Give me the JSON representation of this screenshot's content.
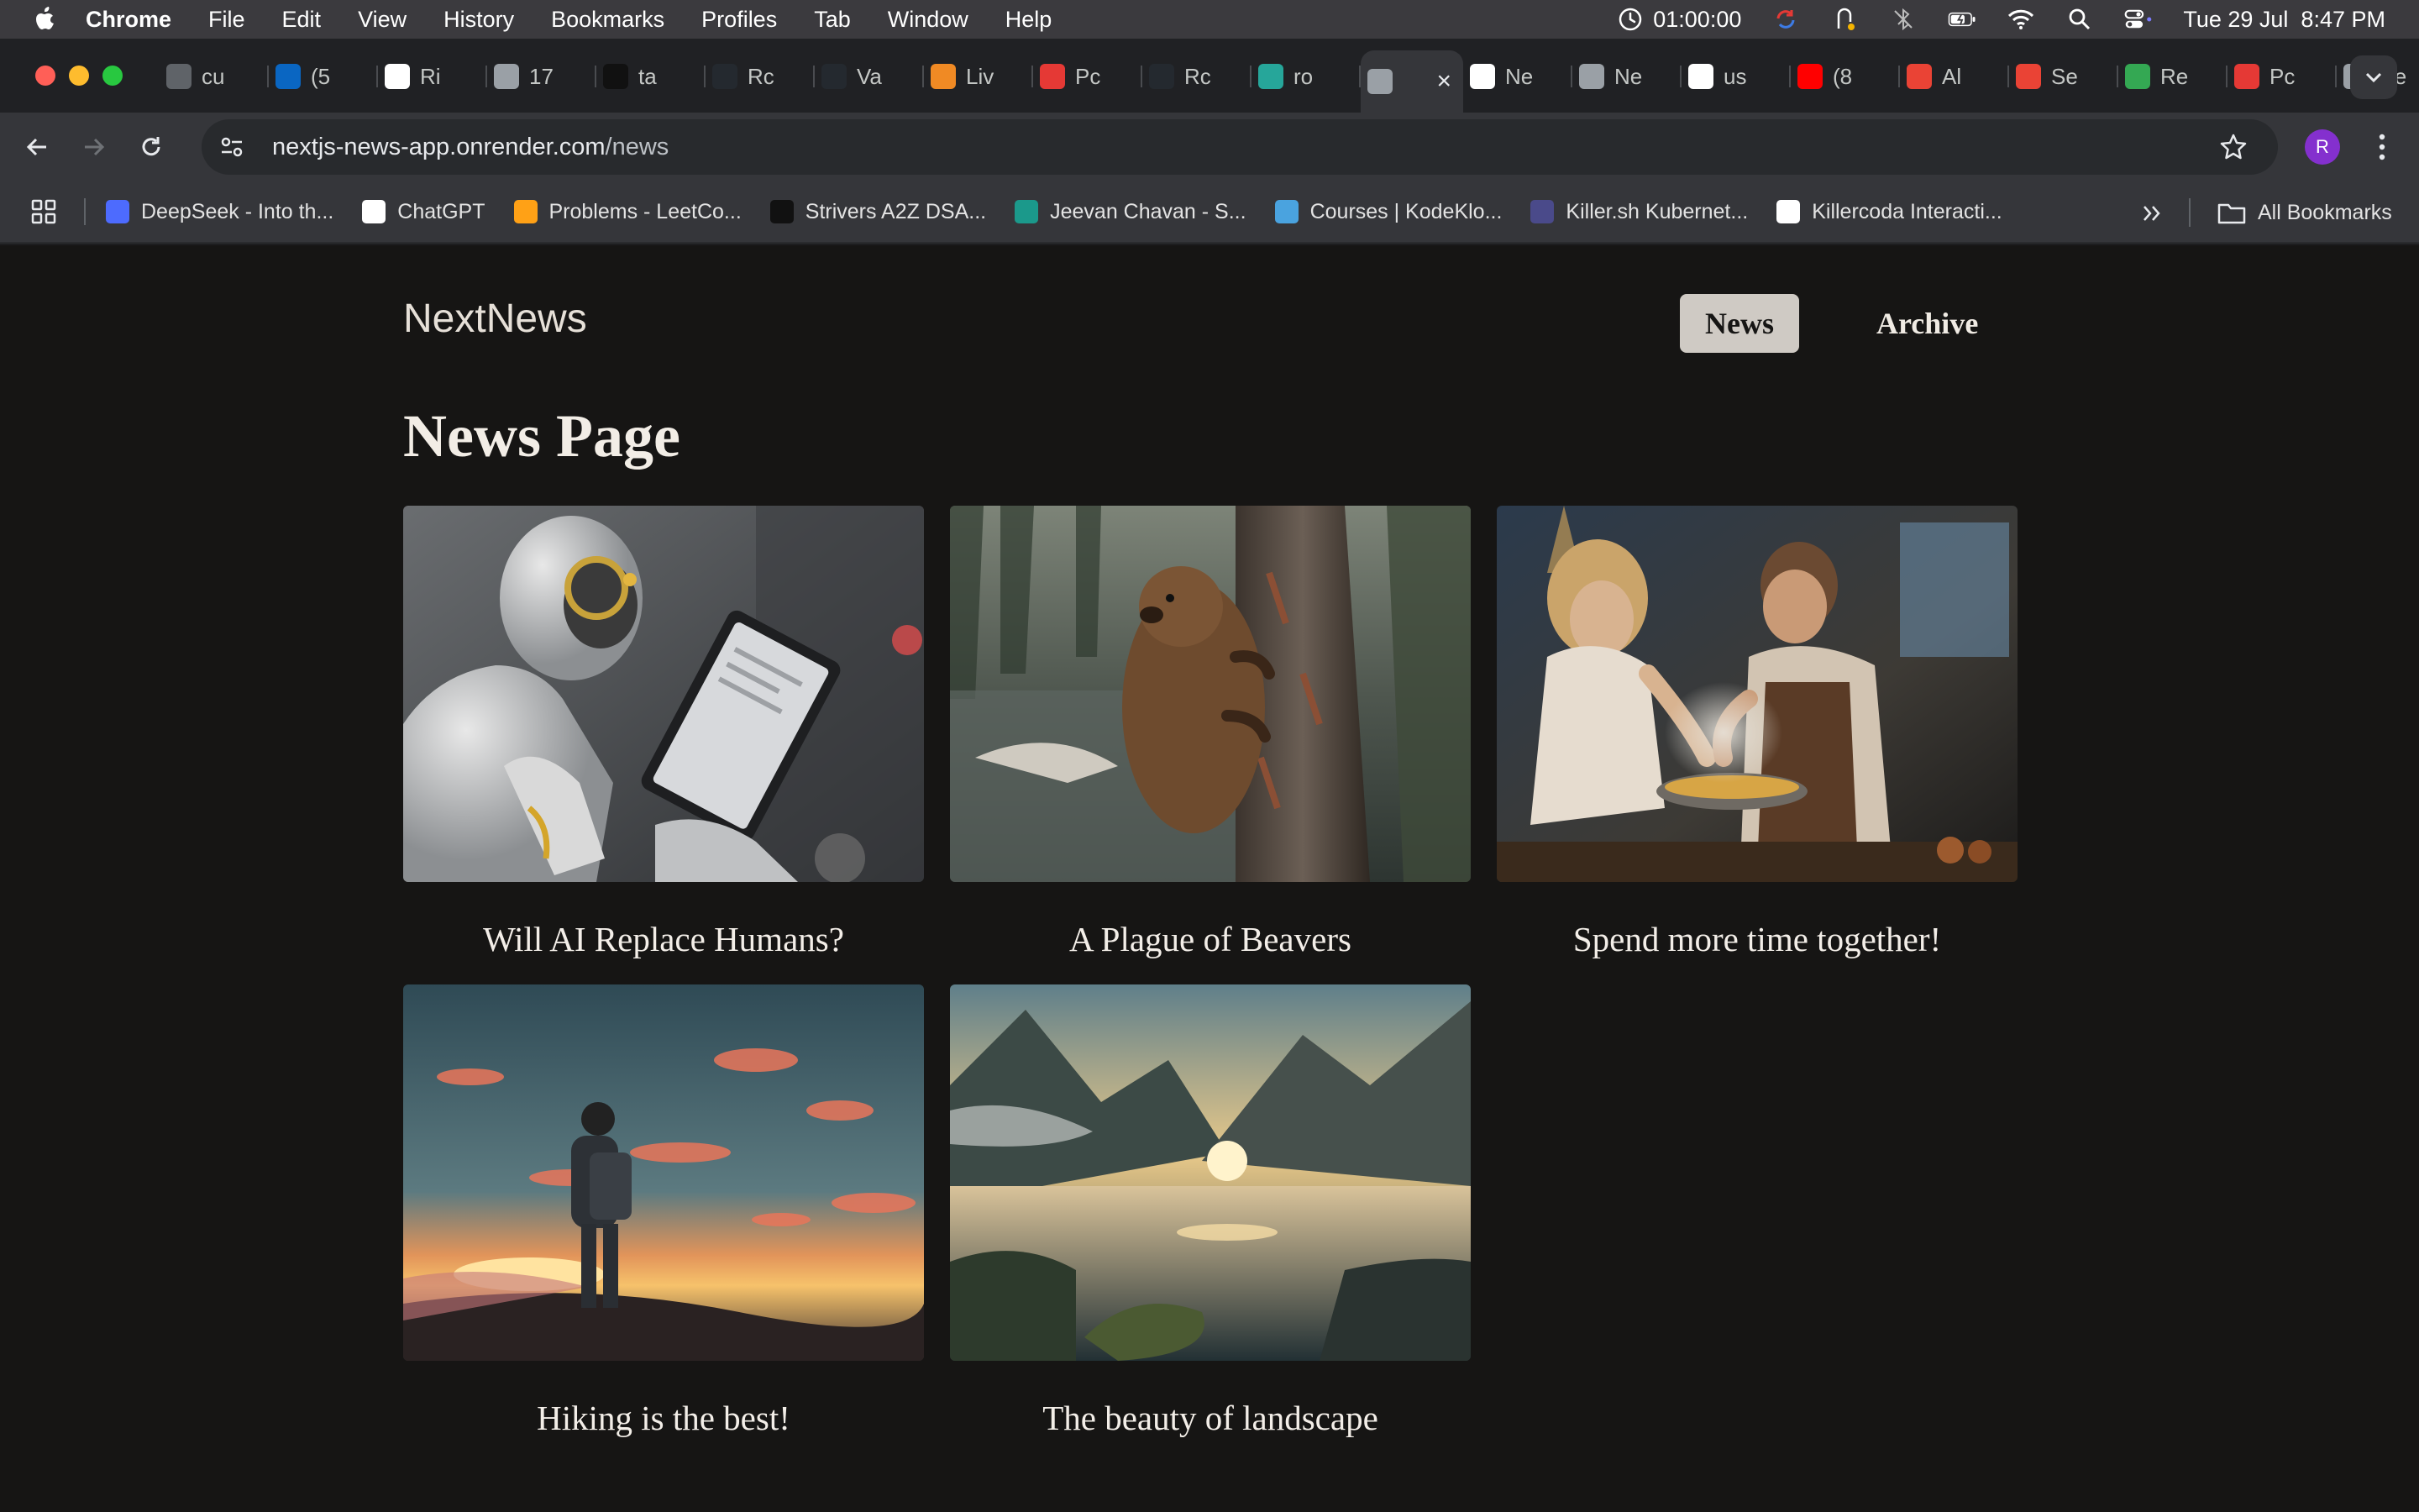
{
  "menubar": {
    "items": [
      "Chrome",
      "File",
      "Edit",
      "View",
      "History",
      "Bookmarks",
      "Profiles",
      "Tab",
      "Window",
      "Help"
    ],
    "timer": "01:00:00",
    "datetime": "Tue 29 Jul  8:47 PM"
  },
  "tabs": [
    {
      "title": "cu",
      "icon": "g-icon",
      "color": "#5f6368"
    },
    {
      "title": "(5",
      "icon": "linkedin-icon",
      "color": "#0a66c2"
    },
    {
      "title": "Ri",
      "icon": "rc-icon",
      "color": "#ffffff"
    },
    {
      "title": "17",
      "icon": "globe-icon",
      "color": "#9aa0a6"
    },
    {
      "title": "ta",
      "icon": "tuf-icon",
      "color": "#111111"
    },
    {
      "title": "Rc",
      "icon": "github-dark-icon",
      "color": "#24292f"
    },
    {
      "title": "Va",
      "icon": "github-icon",
      "color": "#24292f"
    },
    {
      "title": "Liv",
      "icon": "chart-icon",
      "color": "#f08a24"
    },
    {
      "title": "Pc",
      "icon": "flame-icon",
      "color": "#e53935"
    },
    {
      "title": "Rc",
      "icon": "github-icon",
      "color": "#24292f"
    },
    {
      "title": "ro",
      "icon": "diamond-icon",
      "color": "#26a69a"
    },
    {
      "title": "",
      "icon": "page-icon",
      "color": "#9aa0a6",
      "active": true
    },
    {
      "title": "Ne",
      "icon": "link-icon",
      "color": "#ffffff"
    },
    {
      "title": "Ne",
      "icon": "page-icon",
      "color": "#9aa0a6"
    },
    {
      "title": "us",
      "icon": "openai-icon",
      "color": "#ffffff"
    },
    {
      "title": "(8",
      "icon": "youtube-icon",
      "color": "#ff0000"
    },
    {
      "title": "Al",
      "icon": "gmail-icon",
      "color": "#ea4335"
    },
    {
      "title": "Se",
      "icon": "gmail-icon",
      "color": "#ea4335"
    },
    {
      "title": "Re",
      "icon": "drive-icon",
      "color": "#34a853"
    },
    {
      "title": "Pc",
      "icon": "flame-icon",
      "color": "#e53935"
    },
    {
      "title": "Ne",
      "icon": "page-icon",
      "color": "#9aa0a6"
    }
  ],
  "toolbar": {
    "url_host": "nextjs-news-app.onrender.com",
    "url_path": "/news",
    "profile_initial": "R"
  },
  "bookmarks": {
    "items": [
      {
        "label": "DeepSeek - Into th...",
        "color": "#4d6bfe",
        "icon": "deepseek-icon"
      },
      {
        "label": "ChatGPT",
        "color": "#ffffff",
        "icon": "openai-icon"
      },
      {
        "label": "Problems - LeetCo...",
        "color": "#ffa116",
        "icon": "leetcode-icon"
      },
      {
        "label": "Strivers A2Z DSA...",
        "color": "#111111",
        "icon": "tuf-icon"
      },
      {
        "label": "Jeevan Chavan - S...",
        "color": "#1b998b",
        "icon": "c-icon"
      },
      {
        "label": "Courses | KodeKlo...",
        "color": "#4aa3df",
        "icon": "eye-icon"
      },
      {
        "label": "Killer.sh Kubernet...",
        "color": "#4a4a8a",
        "icon": "terminal-icon"
      },
      {
        "label": "Killercoda Interacti...",
        "color": "#ffffff",
        "icon": "k-icon"
      }
    ],
    "all_label": "All Bookmarks"
  },
  "site": {
    "brand": "NextNews",
    "nav": [
      {
        "label": "News",
        "active": true
      },
      {
        "label": "Archive",
        "active": false
      }
    ],
    "heading": "News Page"
  },
  "articles": [
    {
      "title": "Will AI Replace Humans?",
      "image": "robot-with-tablet"
    },
    {
      "title": "A Plague of Beavers",
      "image": "beaver-on-tree"
    },
    {
      "title": "Spend more time together!",
      "image": "couple-cooking"
    },
    {
      "title": "Hiking is the best!",
      "image": "hiker-at-sunset"
    },
    {
      "title": "The beauty of landscape",
      "image": "mountain-lake"
    }
  ]
}
